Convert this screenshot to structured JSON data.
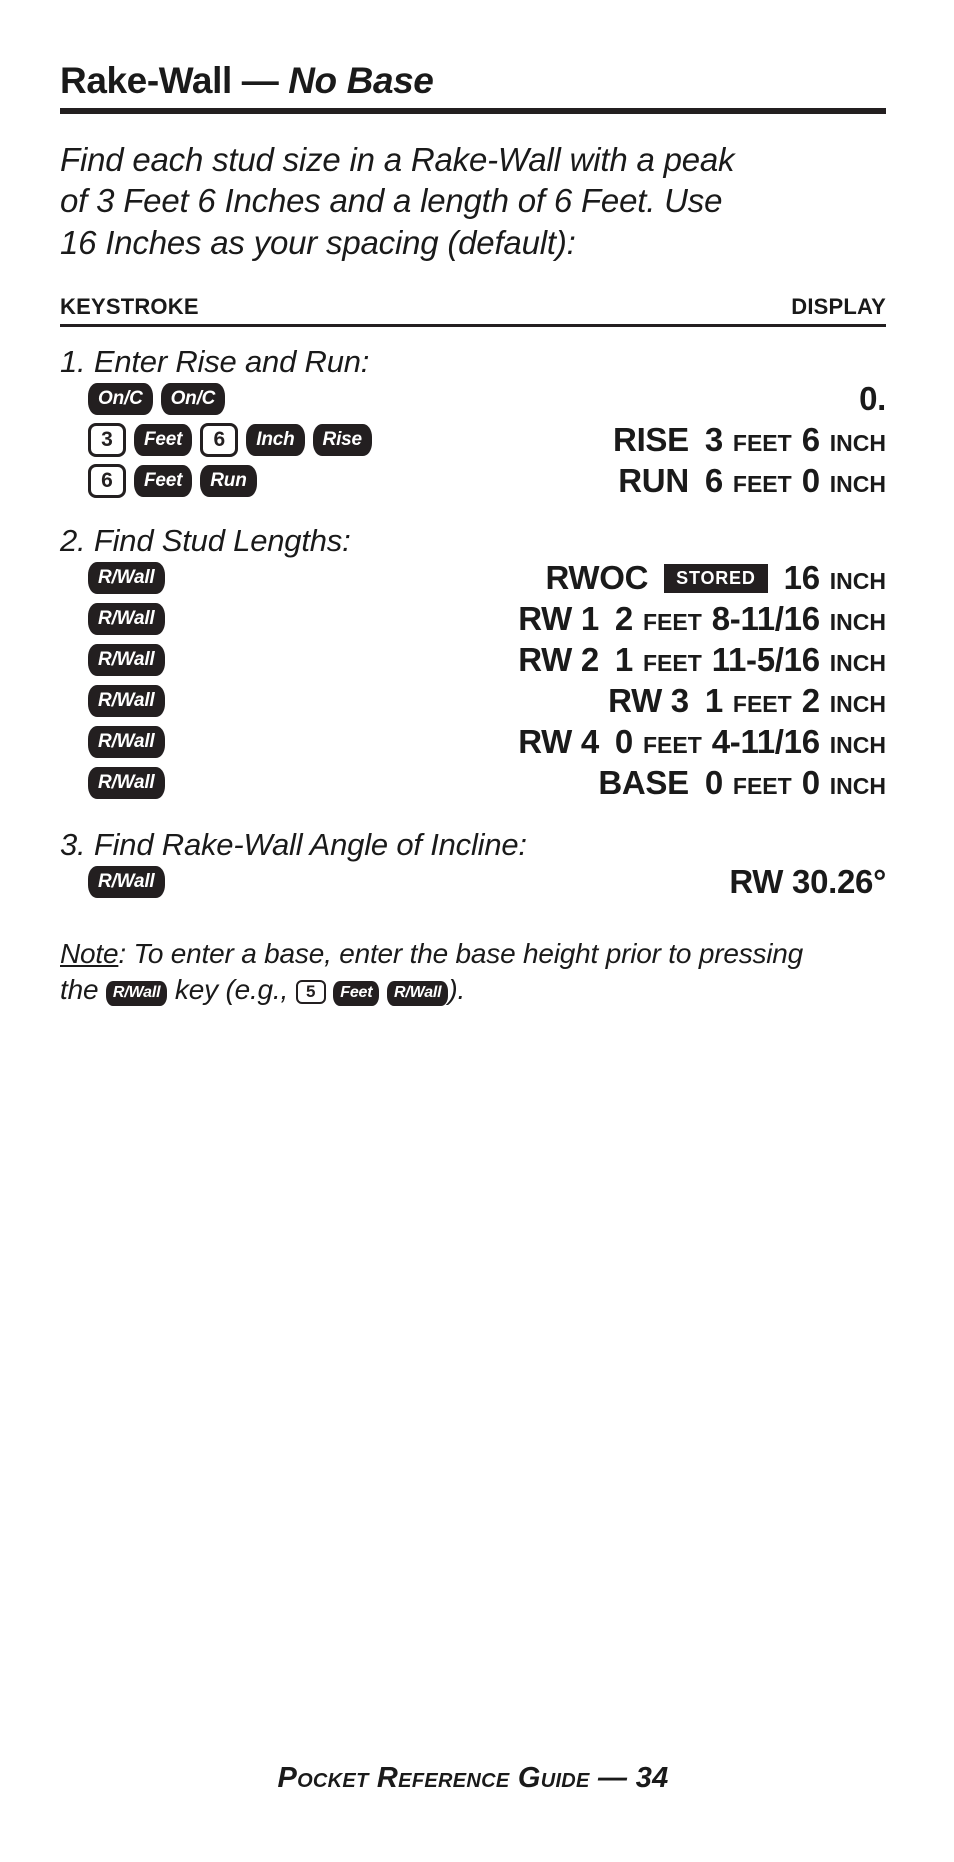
{
  "page": {
    "title_main": "Rake-Wall —",
    "title_emphasis": "No Base",
    "intro": "Find each stud size in a Rake-Wall with a peak of 3 Feet 6 Inches and a length of 6 Feet. Use 16 Inches as your spacing (default):"
  },
  "columns": {
    "keystroke": "KEYSTROKE",
    "display": "DISPLAY"
  },
  "steps": {
    "step1": "1. Enter Rise and Run:",
    "step2": "2. Find Stud Lengths:",
    "step3": "3. Find Rake-Wall Angle of Incline:"
  },
  "keys": {
    "onc": "On/C",
    "feet": "Feet",
    "inch": "Inch",
    "rise": "Rise",
    "run": "Run",
    "rwall": "R/Wall",
    "three": "3",
    "six": "6",
    "five": "5"
  },
  "labels": {
    "feet_unit": "FEET",
    "inch_unit": "INCH",
    "stored": "STORED"
  },
  "rows": {
    "onc": {
      "display_value": "0."
    },
    "rise": {
      "label": "RISE",
      "feet": "3",
      "inch": "6"
    },
    "run": {
      "label": "RUN",
      "feet": "6",
      "inch": "0"
    },
    "rwoc": {
      "label": "RWOC",
      "badge": "STORED",
      "value": "16",
      "unit": "INCH"
    },
    "rw1": {
      "label": "RW 1",
      "feet": "2",
      "inch": "8-11/16"
    },
    "rw2": {
      "label": "RW 2",
      "feet": "1",
      "inch": "11-5/16"
    },
    "rw3": {
      "label": "RW 3",
      "feet": "1",
      "inch": "2"
    },
    "rw4": {
      "label": "RW 4",
      "feet": "0",
      "inch": "4-11/16"
    },
    "base": {
      "label": "BASE",
      "feet": "0",
      "inch": "0"
    },
    "angle": {
      "value": "RW 30.26°"
    }
  },
  "note": {
    "word": "Note",
    "part1": ": To enter a base, enter the base height prior to pressing the",
    "part2": "key (e.g.,",
    "part3": ")."
  },
  "footer": {
    "text": "Pocket Reference Guide — ",
    "page_number": "34"
  }
}
